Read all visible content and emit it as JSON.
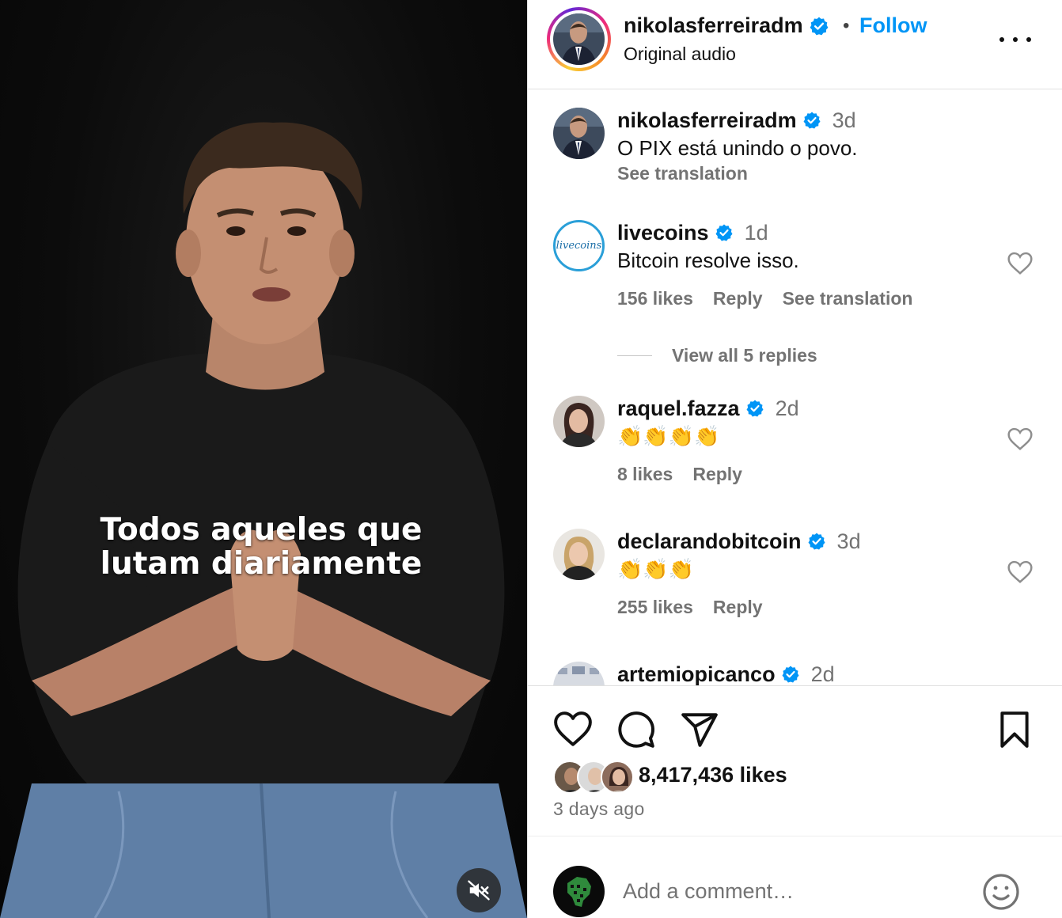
{
  "video": {
    "caption_line1": "Todos aqueles que",
    "caption_line2": "lutam diariamente",
    "muted_icon": "speaker-muted-icon"
  },
  "header": {
    "username": "nikolasferreiradm",
    "verified": true,
    "separator": "•",
    "follow_label": "Follow",
    "audio": "Original audio",
    "more_icon": "more-horizontal-icon"
  },
  "comments": [
    {
      "username": "nikolasferreiradm",
      "verified": true,
      "time": "3d",
      "text": "O PIX está unindo o povo.",
      "see_translation": "See translation"
    },
    {
      "username": "livecoins",
      "verified": true,
      "time": "1d",
      "text": "Bitcoin resolve isso.",
      "likes": "156 likes",
      "reply": "Reply",
      "see_translation": "See translation",
      "view_replies": "View all 5 replies",
      "avatar_text": "livecoins"
    },
    {
      "username": "raquel.fazza",
      "verified": true,
      "time": "2d",
      "text": "👏👏👏👏",
      "likes": "8 likes",
      "reply": "Reply"
    },
    {
      "username": "declarandobitcoin",
      "verified": true,
      "time": "3d",
      "text": "👏👏👏",
      "likes": "255 likes",
      "reply": "Reply"
    },
    {
      "username": "artemiopicanco",
      "verified": true,
      "time": "2d"
    }
  ],
  "actions": {
    "like_icon": "heart-icon",
    "comment_icon": "comment-bubble-icon",
    "share_icon": "send-icon",
    "save_icon": "bookmark-icon",
    "like_count": "8,417,436 likes",
    "posted": "3 days ago"
  },
  "add_comment": {
    "placeholder": "Add a comment…",
    "emoji_icon": "emoji-icon"
  },
  "colors": {
    "accent": "#0095f6",
    "verified": "#0095f6",
    "secondary_text": "#737373"
  }
}
